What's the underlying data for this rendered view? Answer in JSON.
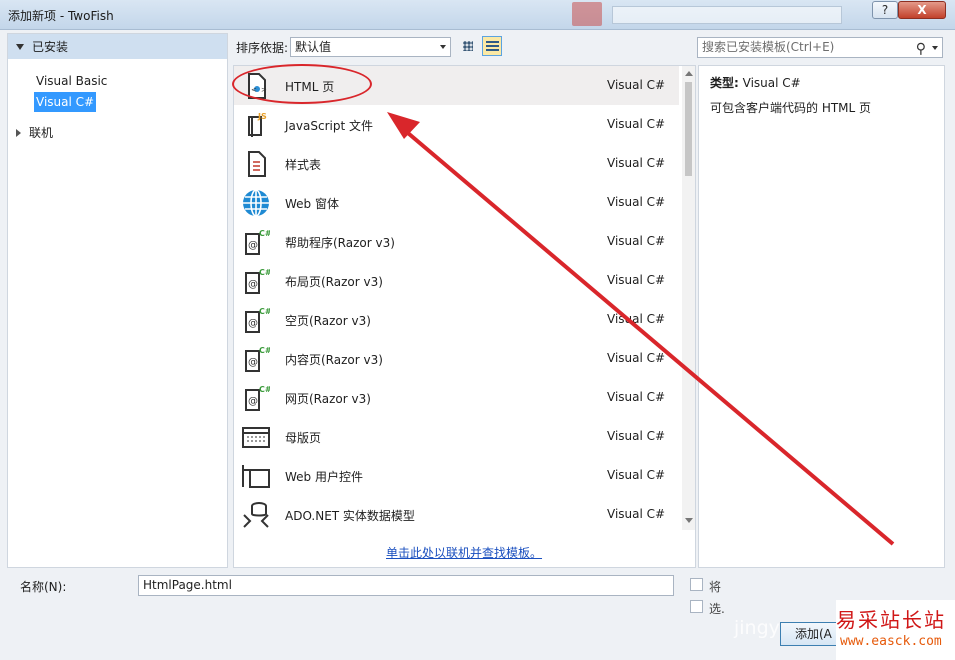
{
  "window": {
    "title": "添加新项 - TwoFish",
    "help_label": "?",
    "close_label": "X"
  },
  "left_panel": {
    "header": "已安装",
    "items": [
      "Visual Basic",
      "Visual C#"
    ],
    "selected": "Visual C#",
    "online": "联机"
  },
  "toolbar": {
    "sort_label": "排序依据:",
    "sort_value": "默认值",
    "search_placeholder": "搜索已安装模板(Ctrl+E)"
  },
  "templates": [
    {
      "name": "HTML 页",
      "lang": "Visual C#",
      "icon": "html-page-icon",
      "selected": true
    },
    {
      "name": "JavaScript 文件",
      "lang": "Visual C#",
      "icon": "javascript-file-icon"
    },
    {
      "name": "样式表",
      "lang": "Visual C#",
      "icon": "stylesheet-icon"
    },
    {
      "name": "Web 窗体",
      "lang": "Visual C#",
      "icon": "globe-icon"
    },
    {
      "name": "帮助程序(Razor v3)",
      "lang": "Visual C#",
      "icon": "razor-cs-icon"
    },
    {
      "name": "布局页(Razor v3)",
      "lang": "Visual C#",
      "icon": "razor-cs-icon"
    },
    {
      "name": "空页(Razor v3)",
      "lang": "Visual C#",
      "icon": "razor-cs-icon"
    },
    {
      "name": "内容页(Razor v3)",
      "lang": "Visual C#",
      "icon": "razor-cs-icon"
    },
    {
      "name": "网页(Razor v3)",
      "lang": "Visual C#",
      "icon": "razor-cs-icon"
    },
    {
      "name": "母版页",
      "lang": "Visual C#",
      "icon": "master-page-icon"
    },
    {
      "name": "Web 用户控件",
      "lang": "Visual C#",
      "icon": "user-control-icon"
    },
    {
      "name": "ADO.NET 实体数据模型",
      "lang": "Visual C#",
      "icon": "entity-model-icon"
    }
  ],
  "online_link": "单击此处以联机并查找模板。",
  "details": {
    "type_label": "类型:",
    "type_value": "Visual C#",
    "description": "可包含客户端代码的 HTML 页"
  },
  "bottom": {
    "name_label": "名称(N):",
    "name_value": "HtmlPage.html",
    "check1": "将",
    "check2": "选.",
    "add_button": "添加(A"
  },
  "watermark": {
    "text": "易采站长站",
    "url": "www.easck.com",
    "jingyan": "jingy"
  },
  "colors": {
    "annotation": "#d9262b",
    "selection": "#3399ff",
    "link": "#1a4fbf"
  }
}
